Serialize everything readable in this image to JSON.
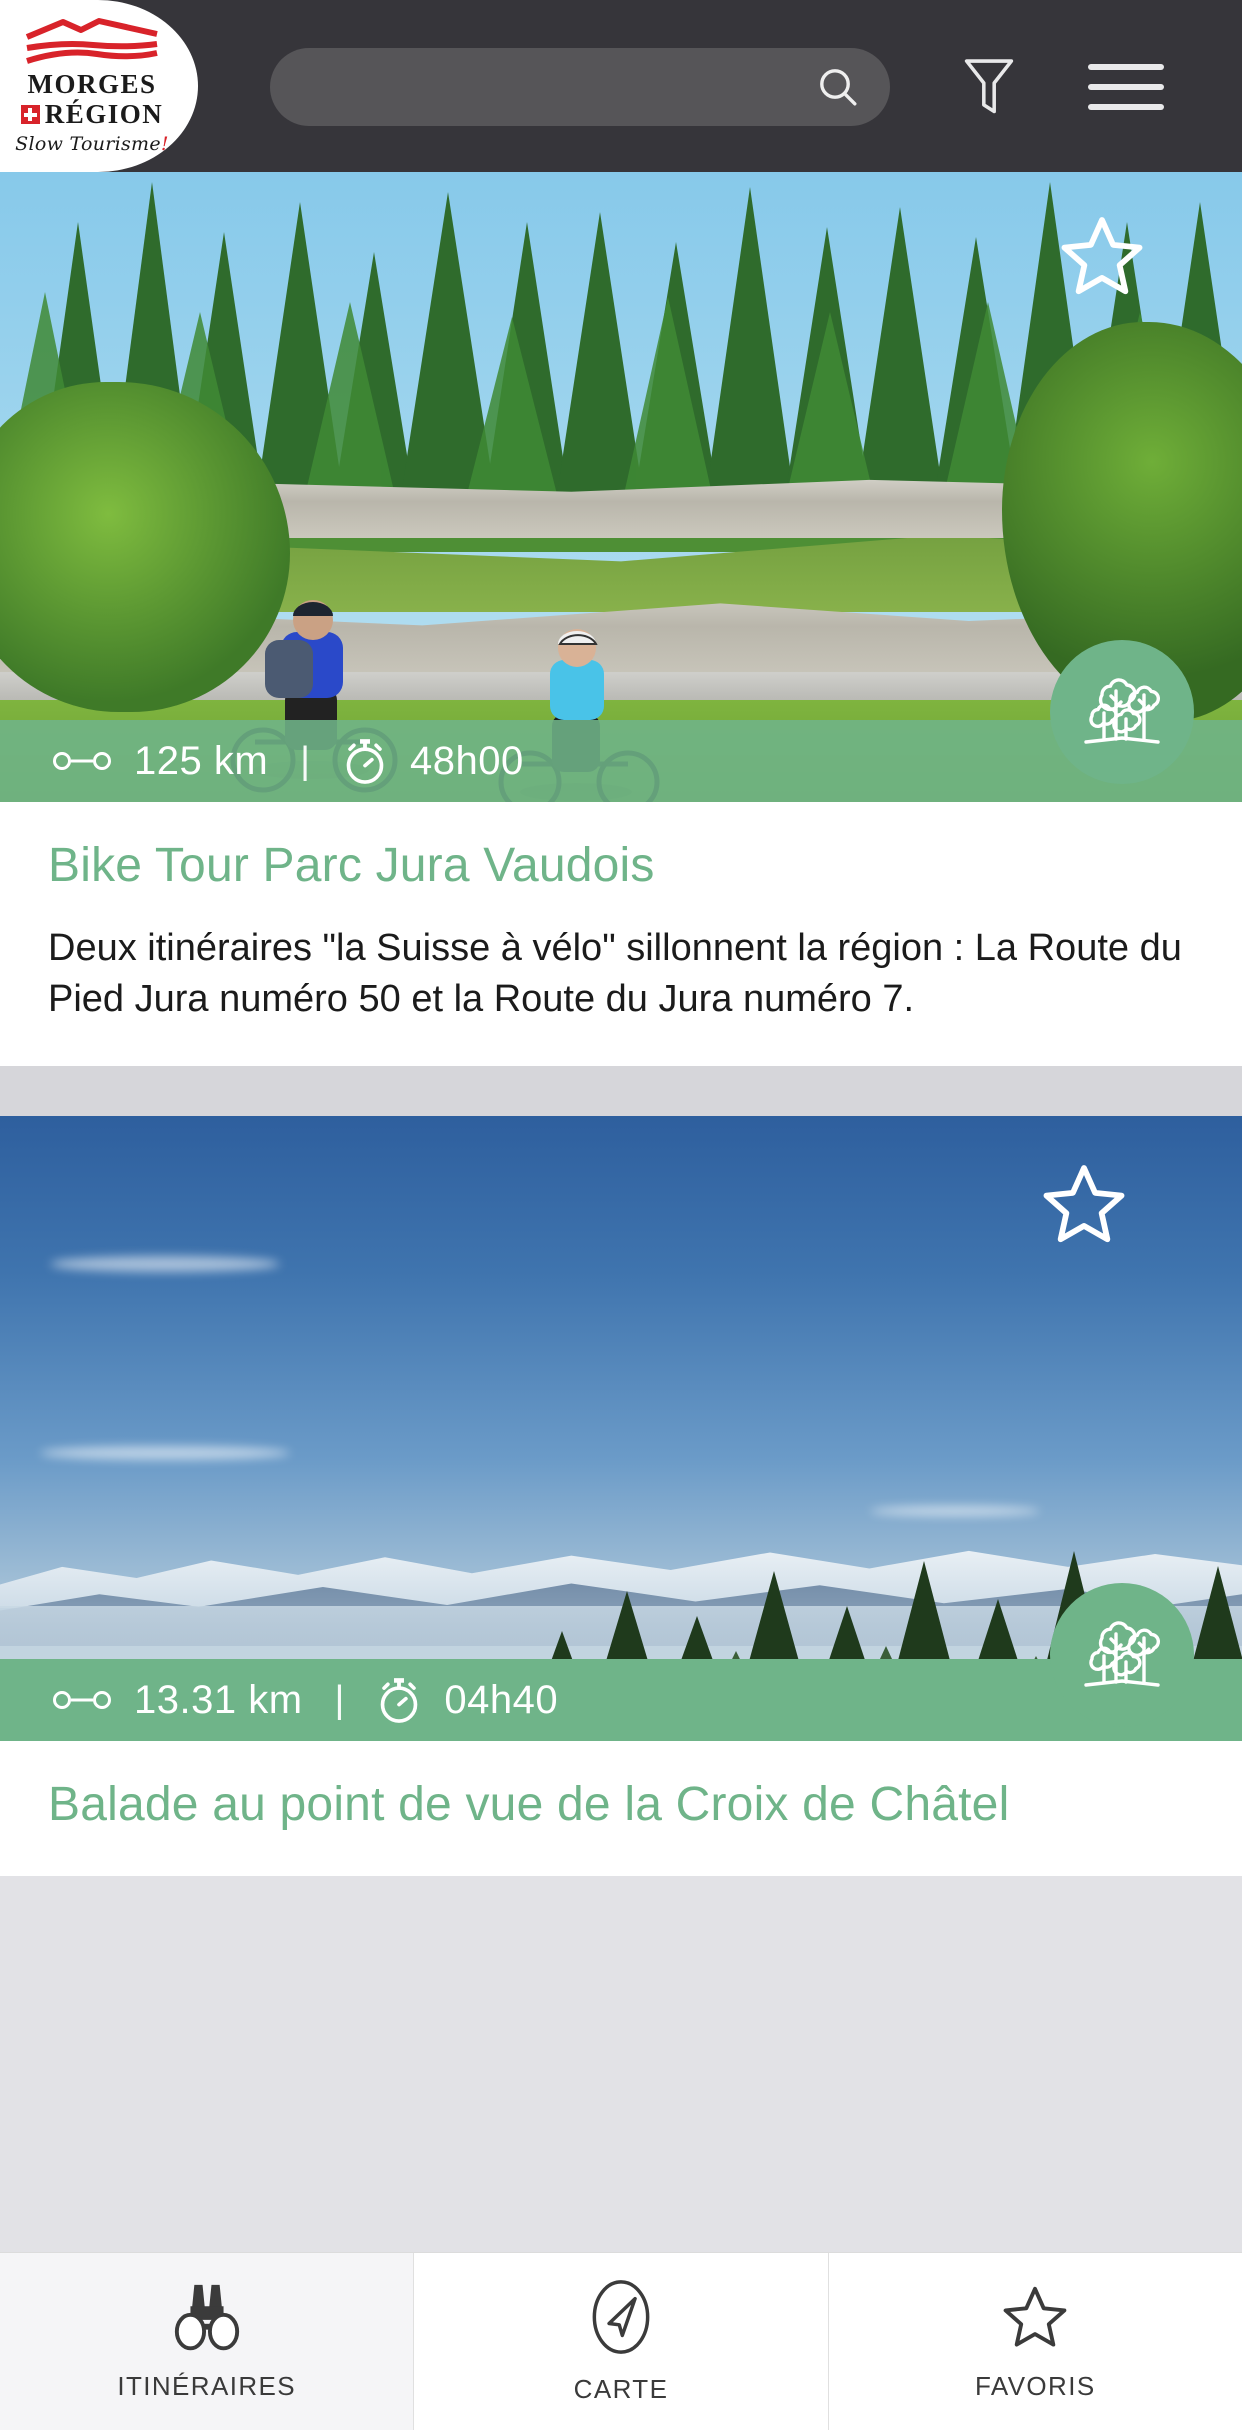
{
  "app": {
    "brand": {
      "name_line1": "MORGES",
      "name_line2": "RÉGION",
      "slogan": "Slow Tourisme",
      "slogan_excl": "!",
      "accent_color": "#d8232a"
    },
    "header": {
      "background_color": "#36353a",
      "search": {
        "placeholder": "",
        "value": ""
      },
      "search_icon": "search-icon",
      "filter_icon": "filter-icon",
      "menu_icon": "hamburger-menu-icon"
    },
    "theme": {
      "green": "#6fb489",
      "title_green": "#6fb489",
      "text_dark": "#1b1b1b"
    }
  },
  "cards": [
    {
      "favorite_icon": "star-outline-icon",
      "favorited": false,
      "distance_icon": "route-distance-icon",
      "distance": "125 km",
      "separator": "|",
      "duration_icon": "stopwatch-icon",
      "duration": "48h00",
      "category_icon": "forest-trees-icon",
      "title": "Bike Tour Parc Jura Vaudois",
      "description": "Deux itinéraires \"la Suisse à vélo\" sillonnent la région : La Route du Pied Jura numéro 50 et la Route du Jura numéro 7.",
      "photo_alt": "two-cyclists-forest-photo"
    },
    {
      "favorite_icon": "star-outline-icon",
      "favorited": false,
      "distance_icon": "route-distance-icon",
      "distance": "13.31 km",
      "separator": "|",
      "duration_icon": "stopwatch-icon",
      "duration": "04h40",
      "category_icon": "forest-trees-icon",
      "title": "Balade au point de vue de la Croix de Châtel",
      "description": "",
      "photo_alt": "alpine-panorama-photo"
    }
  ],
  "bottom_nav": {
    "items": [
      {
        "label": "ITINÉRAIRES",
        "icon": "binoculars-icon",
        "active": true
      },
      {
        "label": "CARTE",
        "icon": "compass-navigation-icon",
        "active": false
      },
      {
        "label": "FAVORIS",
        "icon": "star-outline-icon",
        "active": false
      }
    ]
  }
}
